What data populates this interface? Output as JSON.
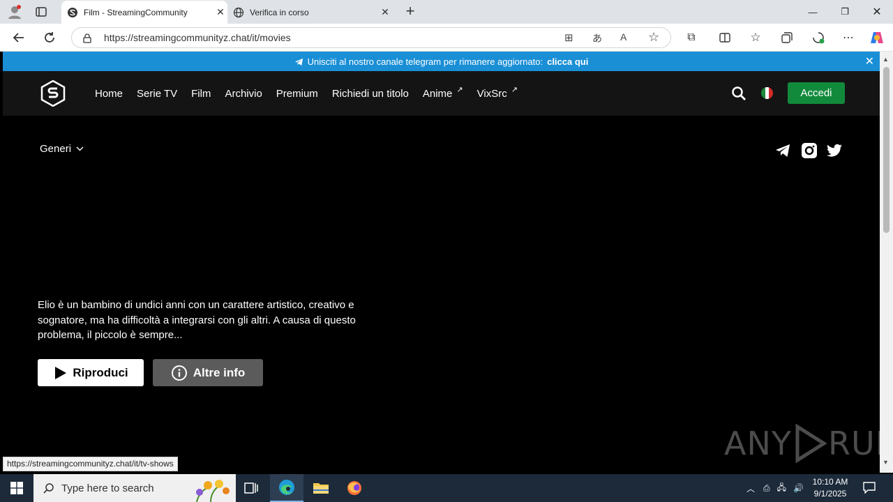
{
  "browser": {
    "tabs": [
      {
        "title": "Film - StreamingCommunity",
        "active": true
      },
      {
        "title": "Verifica in corso",
        "active": false
      }
    ],
    "new_tab_symbol": "+",
    "url": "https://streamingcommunityz.chat/it/movies",
    "status_link": "https://streamingcommunityz.chat/it/tv-shows"
  },
  "banner": {
    "text": "Unisciti al nostro canale telegram per rimanere aggiornato:",
    "link": "clicca qui",
    "close": "✕"
  },
  "header": {
    "nav": [
      {
        "label": "Home",
        "external": false
      },
      {
        "label": "Serie TV",
        "external": false
      },
      {
        "label": "Film",
        "external": false
      },
      {
        "label": "Archivio",
        "external": false
      },
      {
        "label": "Premium",
        "external": false
      },
      {
        "label": "Richiedi un titolo",
        "external": false
      },
      {
        "label": "Anime",
        "external": true
      },
      {
        "label": "VixSrc",
        "external": true
      }
    ],
    "external_symbol": "↗",
    "login": "Accedi"
  },
  "filters": {
    "genres": "Generi"
  },
  "hero": {
    "description": "Elio è un bambino di undici anni con un carattere artistico, creativo e sognatore, ma ha difficoltà a integrarsi con gli altri. A causa di questo problema, il piccolo è sempre...",
    "play": "Riproduci",
    "info": "Altre info"
  },
  "watermark": {
    "left": "ANY",
    "right": "RUN"
  },
  "taskbar": {
    "search_placeholder": "Type here to search",
    "time": "10:10 AM",
    "date": "9/1/2025"
  },
  "colors": {
    "banner": "#1a8fd6",
    "login": "#128a3c",
    "header_bg": "#141414"
  }
}
